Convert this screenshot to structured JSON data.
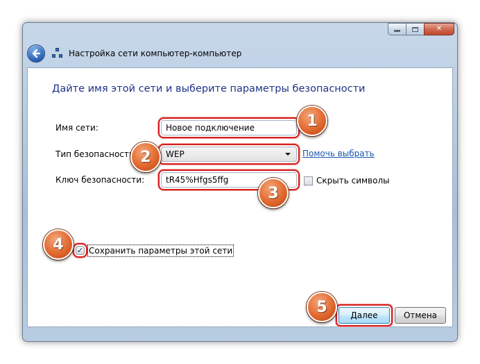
{
  "window": {
    "title": "Настройка сети компьютер-компьютер",
    "controls": {
      "minimize_icon": "minimize-icon",
      "maximize_icon": "maximize-icon",
      "close_icon": "close-icon",
      "close_glyph": "✕"
    }
  },
  "page": {
    "heading": "Дайте имя этой сети и выберите параметры безопасности"
  },
  "form": {
    "network_name": {
      "label": "Имя сети:",
      "value": "Новое подключение"
    },
    "security_type": {
      "label": "Тип безопасности:",
      "value": "WEP",
      "help_link": "Помочь выбрать"
    },
    "security_key": {
      "label": "Ключ безопасности:",
      "value": "tR45%Hfgs5ffg",
      "hide_chars_label": "Скрыть символы",
      "hide_chars_checked": false
    },
    "save_settings": {
      "label": "Сохранить параметры этой сети",
      "checked": true,
      "check_glyph": "✓"
    }
  },
  "buttons": {
    "next": "Далее",
    "cancel": "Отмена"
  },
  "annotations": [
    "1",
    "2",
    "3",
    "4",
    "5"
  ],
  "colors": {
    "heading": "#1e3287",
    "highlight_ring": "#d51e1e",
    "badge": "#e2692f",
    "link": "#1a55b0"
  }
}
